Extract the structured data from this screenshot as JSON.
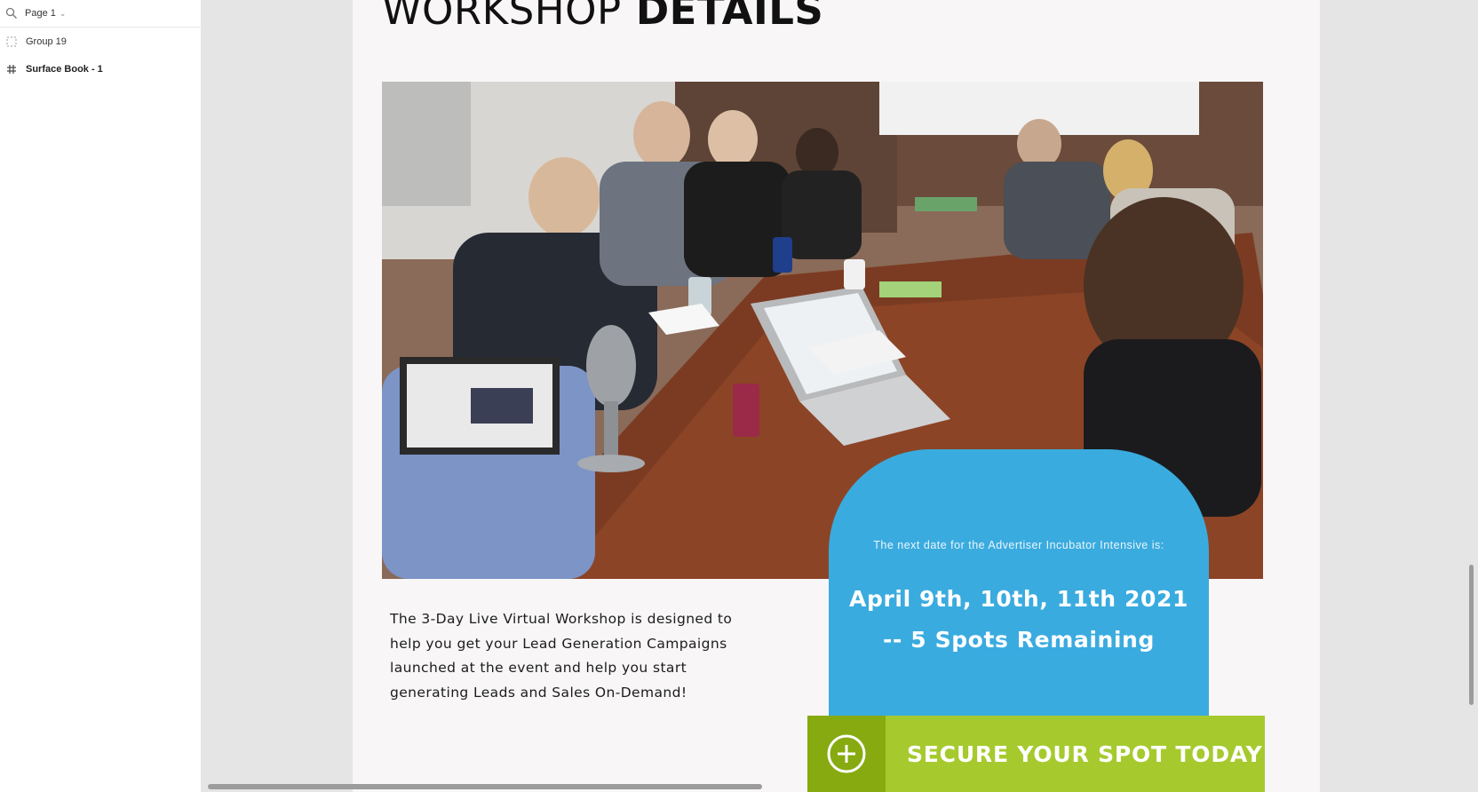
{
  "layers_panel": {
    "page_label": "Page 1",
    "layers": [
      {
        "name": "Group 19",
        "icon": "group-icon"
      },
      {
        "name": "Surface Book - 1",
        "icon": "frame-hash-icon"
      }
    ]
  },
  "frame": {
    "heading_light": "WORKSHOP",
    "heading_bold": "DETAILS",
    "photo_alt": "workshop-photo",
    "intro_text": "The 3-Day Live Virtual Workshop is designed to help you get your Lead Generation Campaigns launched at the event and help you start generating Leads and Sales On-Demand!",
    "date_card": {
      "next_date_text": "The next date for the Advertiser Incubator Intensive is:",
      "dates_line1": "April 9th, 10th, 11th 2021",
      "dates_line2": "-- 5 Spots Remaining",
      "color": "#3aabdf"
    },
    "cta": {
      "label": "SECURE YOUR SPOT TODAY",
      "icon": "plus-circle-icon",
      "color": "#a6ca2e",
      "icon_bg": "#86aa10"
    }
  }
}
